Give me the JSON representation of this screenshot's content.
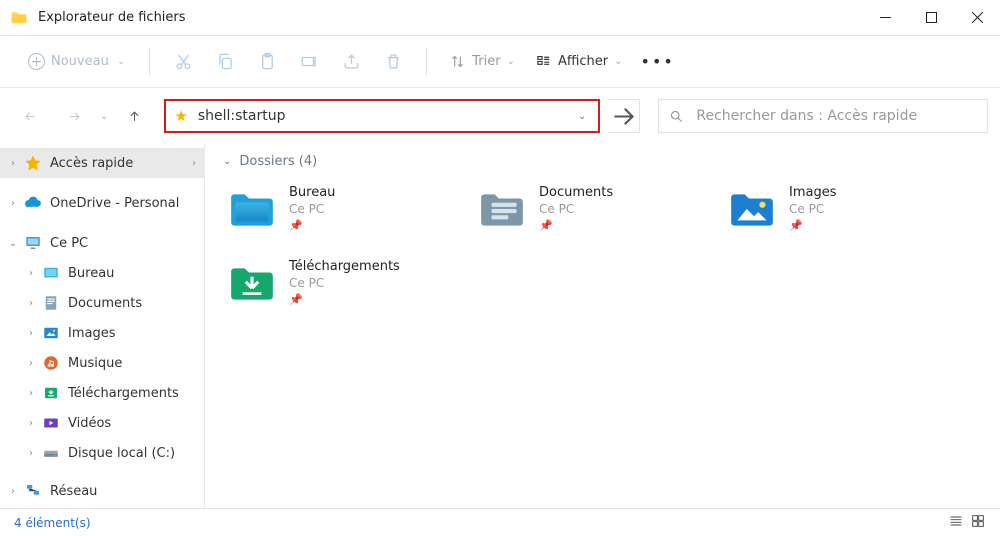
{
  "window": {
    "title": "Explorateur de fichiers"
  },
  "toolbar": {
    "new_label": "Nouveau",
    "sort_label": "Trier",
    "view_label": "Afficher"
  },
  "address": {
    "value": "shell:startup"
  },
  "search": {
    "placeholder": "Rechercher dans : Accès rapide"
  },
  "sidebar": {
    "quick_access": "Accès rapide",
    "onedrive": "OneDrive - Personal",
    "this_pc": "Ce PC",
    "desktop": "Bureau",
    "documents": "Documents",
    "images": "Images",
    "music": "Musique",
    "downloads": "Téléchargements",
    "videos": "Vidéos",
    "disk_c": "Disque local (C:)",
    "network": "Réseau"
  },
  "group": {
    "header": "Dossiers (4)"
  },
  "folders": [
    {
      "name": "Bureau",
      "sub": "Ce PC",
      "icon": "desktop"
    },
    {
      "name": "Documents",
      "sub": "Ce PC",
      "icon": "documents"
    },
    {
      "name": "Images",
      "sub": "Ce PC",
      "icon": "images"
    },
    {
      "name": "Téléchargements",
      "sub": "Ce PC",
      "icon": "downloads"
    }
  ],
  "status": {
    "text": "4 élément(s)"
  }
}
